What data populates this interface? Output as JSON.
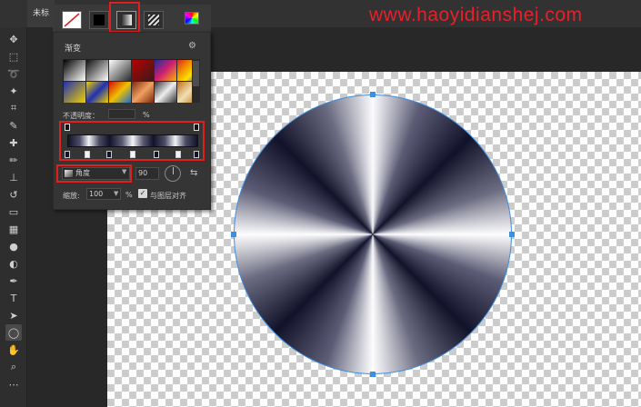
{
  "document": {
    "tab_label": "未标"
  },
  "watermark": {
    "text": "www.haoyidianshej.com"
  },
  "colors": {
    "accent_red": "#e0201e",
    "selection_blue": "#3d8fe0",
    "panel_bg": "#353535"
  },
  "toolbar": {
    "tools": [
      "move-icon",
      "marquee-icon",
      "lasso-icon",
      "magic-wand-icon",
      "crop-icon",
      "eyedropper-icon",
      "healing-icon",
      "brush-icon",
      "clone-stamp-icon",
      "history-brush-icon",
      "eraser-icon",
      "gradient-icon",
      "blur-icon",
      "dodge-icon",
      "pen-icon",
      "type-icon",
      "path-select-icon",
      "ellipse-icon",
      "hand-icon",
      "zoom-icon",
      "more-icon"
    ],
    "active_tool": "ellipse-icon"
  },
  "gradient_panel": {
    "fill_types": [
      "none",
      "solid",
      "gradient",
      "pattern"
    ],
    "selected_fill_type": "gradient",
    "title": "渐变",
    "opacity_label": "不透明度：",
    "opacity_unit": "%",
    "style_value": "角度",
    "angle_value": "90",
    "scale_label": "缩放:",
    "scale_value": "100",
    "scale_unit": "%",
    "align_label": "与图层对齐",
    "align_checked": true,
    "preset_swatches": [
      "linear-gradient(135deg,#000,#fff)",
      "linear-gradient(135deg,#111,#fff)",
      "linear-gradient(135deg,#fff,rgba(255,255,255,0))",
      "linear-gradient(135deg,#b00,#3a1a1a)",
      "linear-gradient(135deg,#1b2f9a,#d21f6f,#f5b400)",
      "linear-gradient(135deg,#e02424,#f08a00,#fbe200,#2a3fcf)",
      "linear-gradient(135deg,#2030b0,#f0d000)",
      "linear-gradient(135deg,#f0d000,#2030b0,#f0d000)",
      "linear-gradient(135deg,#d01010,#f0c000,#1a6cd0)",
      "linear-gradient(135deg,#7a2a10,#f0a060,#7a2a10)",
      "linear-gradient(135deg,#333,#eee,#333)",
      "linear-gradient(135deg,#c07020,#f0e0b0,#c07020)"
    ]
  }
}
